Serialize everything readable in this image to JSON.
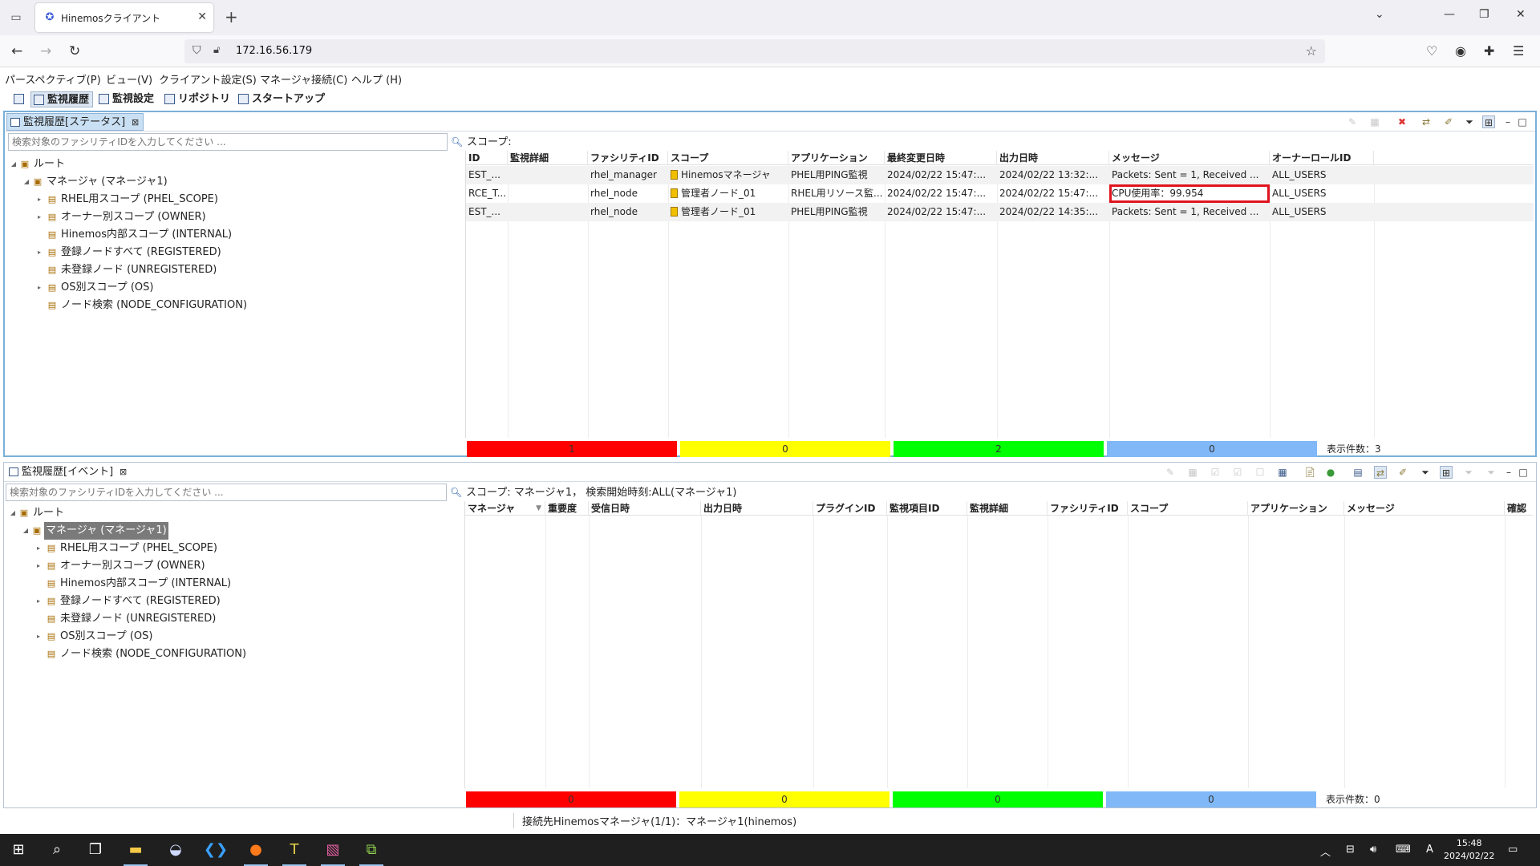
{
  "browser": {
    "tab_title": "Hinemosクライアント",
    "url": "172.16.56.179"
  },
  "menu": [
    "パースペクティブ(P)",
    "ビュー(V)",
    "クライアント設定(S)",
    "マネージャ接続(C)",
    "ヘルプ (H)"
  ],
  "perspectives": [
    "監視履歴",
    "監視設定",
    "リポジトリ",
    "スタートアップ"
  ],
  "status_view": {
    "tab_label": "監視履歴[ステータス]",
    "search_placeholder": "検索対象のファシリティIDを入力してください ...",
    "scope_label": "スコープ:",
    "tree": [
      {
        "label": "ルート"
      },
      {
        "label": "マネージャ (マネージャ1)"
      },
      {
        "label": "RHEL用スコープ (PHEL_SCOPE)"
      },
      {
        "label": "オーナー別スコープ (OWNER)"
      },
      {
        "label": "Hinemos内部スコープ (INTERNAL)"
      },
      {
        "label": "登録ノードすべて (REGISTERED)"
      },
      {
        "label": "未登録ノード (UNREGISTERED)"
      },
      {
        "label": "OS別スコープ (OS)"
      },
      {
        "label": "ノード検索 (NODE_CONFIGURATION)"
      }
    ],
    "columns": [
      "ID",
      "監視詳細",
      "ファシリティID",
      "スコープ",
      "アプリケーション",
      "最終変更日時",
      "出力日時",
      "メッセージ",
      "オーナーロールID"
    ],
    "rows": [
      [
        "EST_...",
        "",
        "rhel_manager",
        "Hinemosマネージャ",
        "PHEL用PING監視",
        "2024/02/22 15:47:...",
        "2024/02/22 13:32:...",
        "Packets: Sent = 1, Received ...",
        "ALL_USERS"
      ],
      [
        "RCE_T...",
        "",
        "rhel_node",
        "管理者ノード_01",
        "RHEL用リソース監...",
        "2024/02/22 15:47:...",
        "2024/02/22 15:47:...",
        "CPU使用率：99.954",
        "ALL_USERS"
      ],
      [
        "EST_...",
        "",
        "rhel_node",
        "管理者ノード_01",
        "PHEL用PING監視",
        "2024/02/22 15:47:...",
        "2024/02/22 14:35:...",
        "Packets: Sent = 1, Received ...",
        "ALL_USERS"
      ]
    ],
    "counts": [
      "1",
      "0",
      "2",
      "0"
    ],
    "total": "表示件数：3"
  },
  "event_view": {
    "tab_label": "監視履歴[イベント]",
    "search_placeholder": "検索対象のファシリティIDを入力してください ...",
    "scope_label": "スコープ: マネージャ1，  検索開始時刻:ALL(マネージャ1)",
    "tree": [
      {
        "label": "ルート"
      },
      {
        "label": "マネージャ (マネージャ1)"
      },
      {
        "label": "RHEL用スコープ (PHEL_SCOPE)"
      },
      {
        "label": "オーナー別スコープ (OWNER)"
      },
      {
        "label": "Hinemos内部スコープ (INTERNAL)"
      },
      {
        "label": "登録ノードすべて (REGISTERED)"
      },
      {
        "label": "未登録ノード (UNREGISTERED)"
      },
      {
        "label": "OS別スコープ (OS)"
      },
      {
        "label": "ノード検索 (NODE_CONFIGURATION)"
      }
    ],
    "columns": [
      "マネージャ",
      "重要度",
      "受信日時",
      "出力日時",
      "プラグインID",
      "監視項目ID",
      "監視詳細",
      "ファシリティID",
      "スコープ",
      "アプリケーション",
      "メッセージ",
      "確認"
    ],
    "counts": [
      "0",
      "0",
      "0",
      "0"
    ],
    "total": "表示件数：0"
  },
  "app_status": "接続先Hinemosマネージャ(1/1)：マネージャ1(hinemos)",
  "colors": {
    "critical": "#ff0000",
    "warning": "#ffff00",
    "info": "#00ff00",
    "unknown": "#80b8f8"
  },
  "clock": {
    "time": "15:48",
    "date": "2024/02/22"
  }
}
